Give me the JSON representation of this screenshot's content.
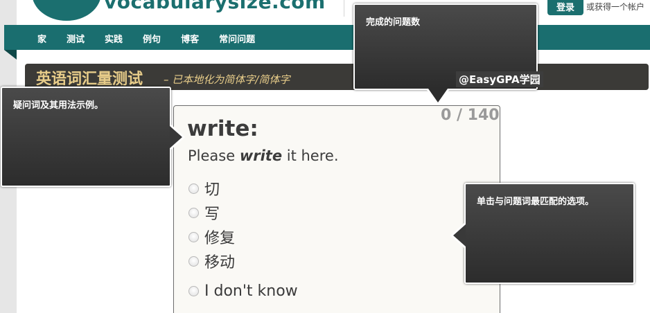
{
  "header": {
    "logo_text": "vocabularysize.com",
    "login_label": "登录",
    "get_account_label": "或获得一个帐户"
  },
  "nav": {
    "items": [
      {
        "label": "家"
      },
      {
        "label": "测试"
      },
      {
        "label": "实践"
      },
      {
        "label": "例句"
      },
      {
        "label": "博客"
      },
      {
        "label": "常问问题"
      }
    ]
  },
  "title_bar": {
    "title": "英语词汇量测试",
    "subtitle": "– 已本地化为简体字/简体字"
  },
  "watermark": "@EasyGPA学园",
  "quiz": {
    "counter": "0 / 140",
    "word": "write:",
    "sentence_before": "Please ",
    "sentence_word": "write",
    "sentence_after": " it here.",
    "options": [
      {
        "label": "切"
      },
      {
        "label": "写"
      },
      {
        "label": "修复"
      },
      {
        "label": "移动"
      },
      {
        "label": "I don't know"
      }
    ]
  },
  "tooltips": {
    "completed": "完成的问题数",
    "example": "疑问词及其用法示例。",
    "instruction": "单击与问题词最匹配的选项。"
  },
  "colors": {
    "brand_teal": "#1a6e6f",
    "title_gold": "#e8cd8a",
    "title_bar_bg": "#3b3a37"
  }
}
